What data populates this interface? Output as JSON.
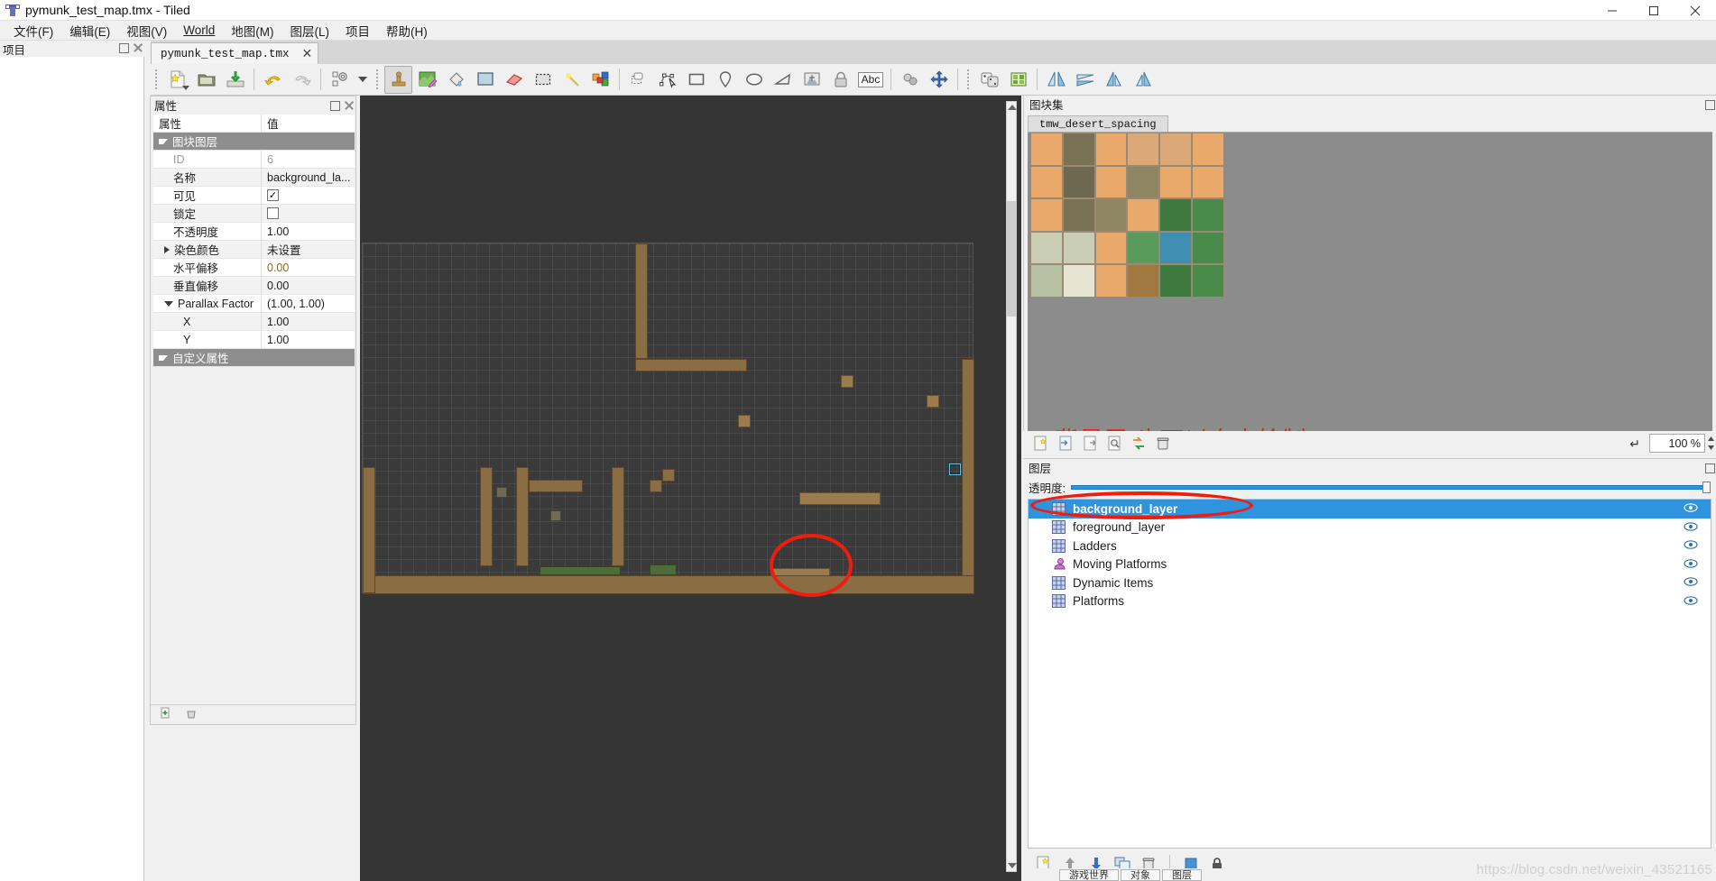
{
  "window": {
    "title": "pymunk_test_map.tmx - Tiled",
    "icon": "tiled-logo-icon",
    "controls": {
      "minimize": "─",
      "maximize": "□",
      "close": "✕"
    }
  },
  "menubar": [
    {
      "label": "文件(F)",
      "mnemonic": "F"
    },
    {
      "label": "编辑(E)",
      "mnemonic": "E"
    },
    {
      "label": "视图(V)",
      "mnemonic": "V"
    },
    {
      "label": "World",
      "mnemonic": "W"
    },
    {
      "label": "地图(M)",
      "mnemonic": "M"
    },
    {
      "label": "图层(L)",
      "mnemonic": "L"
    },
    {
      "label": "项目",
      "mnemonic": ""
    },
    {
      "label": "帮助(H)",
      "mnemonic": "H"
    }
  ],
  "project_dock": {
    "title": "项目"
  },
  "tabs": [
    {
      "label": "pymunk_test_map.tmx",
      "close": "✕",
      "active": true
    }
  ],
  "toolbar": {
    "items": [
      {
        "name": "new-map-button",
        "icon": "new-file-icon"
      },
      {
        "name": "open-file-button",
        "icon": "open-folder-icon"
      },
      {
        "name": "save-file-button",
        "icon": "save-disk-icon"
      },
      {
        "name": "undo-button",
        "icon": "undo-arrow-icon"
      },
      {
        "name": "redo-button",
        "icon": "redo-arrow-icon"
      },
      {
        "name": "commands-button",
        "icon": "gear-cogs-icon"
      },
      {
        "name": "stamp-brush-tool",
        "icon": "stamp-icon",
        "active": true
      },
      {
        "name": "terrain-brush-tool",
        "icon": "terrain-pencil-icon"
      },
      {
        "name": "fill-tool",
        "icon": "paint-bucket-icon"
      },
      {
        "name": "rectangle-fill-tool",
        "icon": "rectangle-fill-icon"
      },
      {
        "name": "eraser-tool",
        "icon": "eraser-icon"
      },
      {
        "name": "rect-select-tool",
        "icon": "marquee-select-icon"
      },
      {
        "name": "magic-wand-tool",
        "icon": "magic-wand-icon"
      },
      {
        "name": "select-same-tile-tool",
        "icon": "same-tile-icon"
      },
      {
        "name": "select-object-tool",
        "icon": "object-select-icon"
      },
      {
        "name": "edit-polygons-tool",
        "icon": "edit-polygon-icon"
      },
      {
        "name": "insert-rectangle-tool",
        "icon": "insert-rectangle-icon"
      },
      {
        "name": "insert-point-tool",
        "icon": "map-pin-icon"
      },
      {
        "name": "insert-ellipse-tool",
        "icon": "ellipse-icon"
      },
      {
        "name": "insert-polygon-tool",
        "icon": "polygon-icon"
      },
      {
        "name": "insert-tile-tool",
        "icon": "insert-tile-icon"
      },
      {
        "name": "insert-template-tool",
        "icon": "template-lock-icon"
      },
      {
        "name": "insert-text-tool",
        "icon": "text-abc-icon",
        "label": "Abc"
      },
      {
        "name": "shape-fill-tool",
        "icon": "shape-fill-icon"
      },
      {
        "name": "pan-tool",
        "icon": "move-arrows-icon"
      },
      {
        "name": "random-mode-button",
        "icon": "dice-icon"
      },
      {
        "name": "tileset-view-button",
        "icon": "tileset-image-icon"
      },
      {
        "name": "flip-horizontal-button",
        "icon": "flip-horizontal-icon"
      },
      {
        "name": "flip-vertical-button",
        "icon": "flip-vertical-icon"
      },
      {
        "name": "rotate-left-button",
        "icon": "rotate-left-icon"
      },
      {
        "name": "rotate-right-button",
        "icon": "rotate-right-icon"
      }
    ]
  },
  "properties_dock": {
    "title": "属性",
    "columns": [
      "属性",
      "值"
    ],
    "group_label": "图块图层",
    "rows": [
      {
        "key": "ID",
        "value": "6",
        "type": "readonly"
      },
      {
        "key": "名称",
        "value": "background_la...",
        "type": "text"
      },
      {
        "key": "可见",
        "value": "✓",
        "type": "checkbox-checked"
      },
      {
        "key": "锁定",
        "value": "",
        "type": "checkbox-unchecked"
      },
      {
        "key": "不透明度",
        "value": "1.00",
        "type": "number"
      },
      {
        "key": "染色颜色",
        "value": "未设置",
        "type": "expandable"
      },
      {
        "key": "水平偏移",
        "value": "0.00",
        "type": "number"
      },
      {
        "key": "垂直偏移",
        "value": "0.00",
        "type": "number"
      },
      {
        "key": "Parallax Factor",
        "value": "(1.00, 1.00)",
        "type": "group-open"
      },
      {
        "key": "X",
        "value": "1.00",
        "type": "number-sub"
      },
      {
        "key": "Y",
        "value": "1.00",
        "type": "number-sub"
      }
    ],
    "custom_section": "自定义属性"
  },
  "tileset_dock": {
    "title": "图块集",
    "tabs": [
      {
        "label": "tmw_desert_spacing",
        "active": true
      }
    ],
    "annotation": "背景层 也可以自由绘制",
    "toolbar": [
      {
        "name": "new-tileset-button",
        "icon": "new-tileset-icon"
      },
      {
        "name": "import-tileset-button",
        "icon": "import-icon"
      },
      {
        "name": "export-tileset-button",
        "icon": "export-icon"
      },
      {
        "name": "edit-tileset-button",
        "icon": "inspect-icon"
      },
      {
        "name": "replace-tileset-button",
        "icon": "swap-arrows-icon"
      },
      {
        "name": "remove-tileset-button",
        "icon": "trash-icon"
      }
    ],
    "reset_icon": "reset-zoom-icon",
    "zoom_value": "100 %"
  },
  "layers_dock": {
    "title": "图层",
    "opacity_label": "透明度:",
    "opacity_value": 100,
    "layers": [
      {
        "name": "background_layer",
        "icon": "tile-layer-icon",
        "selected": true,
        "visible": true
      },
      {
        "name": "foreground_layer",
        "icon": "tile-layer-icon",
        "selected": false,
        "visible": true
      },
      {
        "name": "Ladders",
        "icon": "tile-layer-icon",
        "selected": false,
        "visible": true
      },
      {
        "name": "Moving Platforms",
        "icon": "object-layer-icon",
        "selected": false,
        "visible": true
      },
      {
        "name": "Dynamic Items",
        "icon": "tile-layer-icon",
        "selected": false,
        "visible": true
      },
      {
        "name": "Platforms",
        "icon": "tile-layer-icon",
        "selected": false,
        "visible": true
      }
    ],
    "footer": [
      {
        "name": "new-layer-button",
        "icon": "new-layer-icon"
      },
      {
        "name": "raise-layer-button",
        "icon": "arrow-up-icon"
      },
      {
        "name": "lower-layer-button",
        "icon": "arrow-down-icon"
      },
      {
        "name": "duplicate-layer-button",
        "icon": "duplicate-icon"
      },
      {
        "name": "delete-layer-button",
        "icon": "trash-icon"
      },
      {
        "name": "show-hide-others-button",
        "icon": "square-blue-icon"
      },
      {
        "name": "lock-layer-button",
        "icon": "lock-icon"
      }
    ]
  },
  "bottom_strip": {
    "cells": [
      "游戏世界",
      "对象",
      "图层"
    ]
  },
  "watermark": "https://blog.csdn.net/weixin_43521165",
  "colors": {
    "accent": "#2f93dd",
    "annotation": "#f01d0f",
    "canvas_bg": "#353535",
    "panel_bg": "#f0f0f0",
    "tileset_bg": "#8c8c8c"
  }
}
